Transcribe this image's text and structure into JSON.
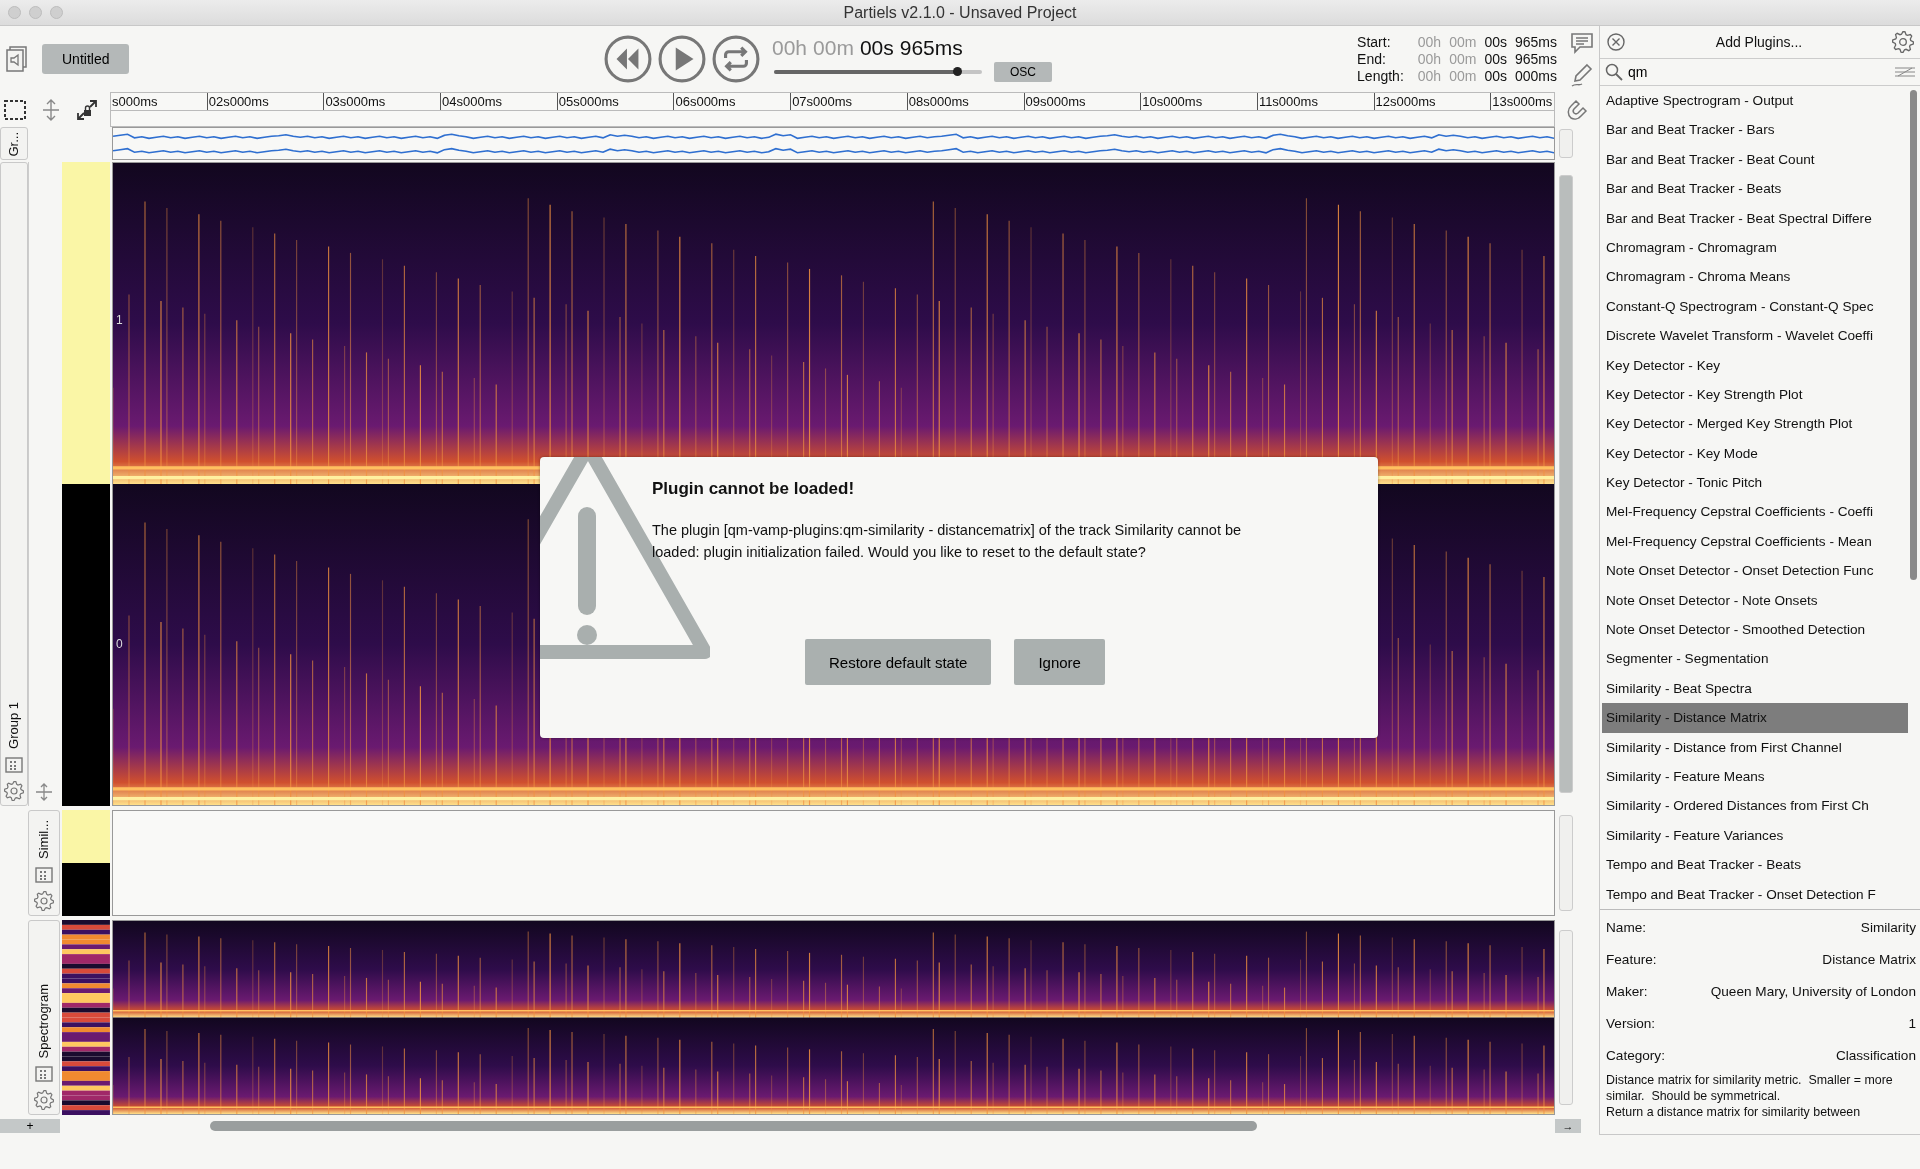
{
  "window": {
    "title": "Partiels v2.1.0 - Unsaved Project"
  },
  "toolbar": {
    "document_button": "Untitled",
    "time": [
      {
        "text": "00h",
        "dim": true
      },
      {
        "text": "00m",
        "dim": true
      },
      {
        "text": "00s",
        "dim": false
      },
      {
        "text": "965ms",
        "dim": false
      }
    ],
    "playhead": {
      "level": 0.88
    },
    "osc_button": "OSC",
    "range": [
      {
        "label": "Start:",
        "parts": [
          {
            "text": "00h",
            "dim": true
          },
          {
            "text": "00m",
            "dim": true
          },
          {
            "text": "00s",
            "dim": false
          },
          {
            "text": "965ms",
            "dim": false
          }
        ]
      },
      {
        "label": "End:",
        "parts": [
          {
            "text": "00h",
            "dim": true
          },
          {
            "text": "00m",
            "dim": true
          },
          {
            "text": "00s",
            "dim": false
          },
          {
            "text": "965ms",
            "dim": false
          }
        ]
      },
      {
        "label": "Length:",
        "parts": [
          {
            "text": "00h",
            "dim": true
          },
          {
            "text": "00m",
            "dim": true
          },
          {
            "text": "00s",
            "dim": false
          },
          {
            "text": "000ms",
            "dim": false
          }
        ]
      }
    ]
  },
  "ruler": {
    "labels": [
      "s000ms",
      "02s000ms",
      "03s000ms",
      "04s000ms",
      "05s000ms",
      "06s000ms",
      "07s000ms",
      "08s000ms",
      "09s000ms",
      "10s000ms",
      "11s000ms",
      "12s000ms",
      "13s000ms"
    ]
  },
  "tracks": [
    {
      "kind": "waveform",
      "label": "Gr..."
    },
    {
      "kind": "group",
      "label": "Group 1",
      "scale_labels": [
        "1",
        "0"
      ]
    },
    {
      "kind": "empty",
      "label": "Simil..."
    },
    {
      "kind": "spectrogram",
      "label": "Spectrogram"
    }
  ],
  "scroll": {
    "add_button": "+",
    "end_button": "→"
  },
  "plugin_panel": {
    "title": "Add Plugins...",
    "search": {
      "value": "qm"
    },
    "items": [
      {
        "label": "Adaptive Spectrogram - Output",
        "selected": false
      },
      {
        "label": "Bar and Beat Tracker - Bars",
        "selected": false
      },
      {
        "label": "Bar and Beat Tracker - Beat Count",
        "selected": false
      },
      {
        "label": "Bar and Beat Tracker - Beats",
        "selected": false
      },
      {
        "label": "Bar and Beat Tracker - Beat Spectral Differe",
        "selected": false
      },
      {
        "label": "Chromagram - Chromagram",
        "selected": false
      },
      {
        "label": "Chromagram - Chroma Means",
        "selected": false
      },
      {
        "label": "Constant-Q Spectrogram - Constant-Q Spec",
        "selected": false
      },
      {
        "label": "Discrete Wavelet Transform - Wavelet Coeffi",
        "selected": false
      },
      {
        "label": "Key Detector - Key",
        "selected": false
      },
      {
        "label": "Key Detector - Key Strength Plot",
        "selected": false
      },
      {
        "label": "Key Detector - Merged Key Strength Plot",
        "selected": false
      },
      {
        "label": "Key Detector - Key Mode",
        "selected": false
      },
      {
        "label": "Key Detector - Tonic Pitch",
        "selected": false
      },
      {
        "label": "Mel-Frequency Cepstral Coefficients - Coeffi",
        "selected": false
      },
      {
        "label": "Mel-Frequency Cepstral Coefficients - Mean",
        "selected": false
      },
      {
        "label": "Note Onset Detector - Onset Detection Func",
        "selected": false
      },
      {
        "label": "Note Onset Detector - Note Onsets",
        "selected": false
      },
      {
        "label": "Note Onset Detector - Smoothed Detection",
        "selected": false
      },
      {
        "label": "Segmenter - Segmentation",
        "selected": false
      },
      {
        "label": "Similarity - Beat Spectra",
        "selected": false
      },
      {
        "label": "Similarity - Distance Matrix",
        "selected": true
      },
      {
        "label": "Similarity - Distance from First Channel",
        "selected": false
      },
      {
        "label": "Similarity - Feature Means",
        "selected": false
      },
      {
        "label": "Similarity - Ordered Distances from First Ch",
        "selected": false
      },
      {
        "label": "Similarity - Feature Variances",
        "selected": false
      },
      {
        "label": "Tempo and Beat Tracker - Beats",
        "selected": false
      },
      {
        "label": "Tempo and Beat Tracker - Onset Detection F",
        "selected": false
      }
    ],
    "info": [
      {
        "key": "Name:",
        "value": "Similarity"
      },
      {
        "key": "Feature:",
        "value": "Distance Matrix"
      },
      {
        "key": "Maker:",
        "value": "Queen Mary, University of London"
      },
      {
        "key": "Version:",
        "value": "1"
      },
      {
        "key": "Category:",
        "value": "Classification"
      }
    ],
    "description": [
      "Distance matrix for similarity metric.  Smaller = more similar.  Should be symmetrical.",
      "Return a distance matrix for similarity between"
    ]
  },
  "dialog": {
    "title": "Plugin cannot be loaded!",
    "message": "The plugin [qm-vamp-plugins:qm-similarity - distancematrix] of the track Similarity cannot be loaded: plugin initialization failed. Would you like to reset to the default state?",
    "buttons": [
      "Restore default state",
      "Ignore"
    ]
  }
}
